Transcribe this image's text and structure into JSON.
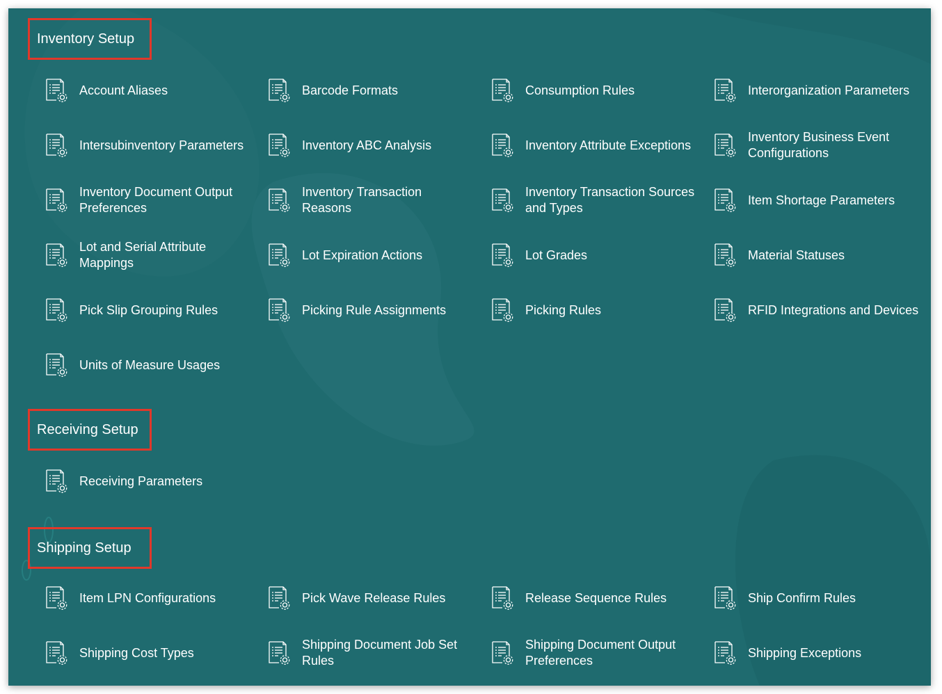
{
  "colors": {
    "background": "#1f6b6f",
    "highlight_border": "#e1382a",
    "text": "#ffffff"
  },
  "icon_name": "task-list-gear-icon",
  "sections": [
    {
      "title": "Inventory Setup",
      "items": [
        "Account Aliases",
        "Barcode Formats",
        "Consumption Rules",
        "Interorganization Parameters",
        "Intersubinventory Parameters",
        "Inventory ABC Analysis",
        "Inventory Attribute Exceptions",
        "Inventory Business Event Configurations",
        "Inventory Document Output Preferences",
        "Inventory Transaction Reasons",
        "Inventory Transaction Sources and Types",
        "Item Shortage Parameters",
        "Lot and Serial Attribute Mappings",
        "Lot Expiration Actions",
        "Lot Grades",
        "Material Statuses",
        "Pick Slip Grouping Rules",
        "Picking Rule Assignments",
        "Picking Rules",
        "RFID Integrations and Devices",
        "Units of Measure Usages"
      ]
    },
    {
      "title": "Receiving Setup",
      "items": [
        "Receiving Parameters"
      ]
    },
    {
      "title": "Shipping Setup",
      "items": [
        "Item LPN Configurations",
        "Pick Wave Release Rules",
        "Release Sequence Rules",
        "Ship Confirm Rules",
        "Shipping Cost Types",
        "Shipping Document Job Set Rules",
        "Shipping Document Output Preferences",
        "Shipping Exceptions"
      ]
    }
  ]
}
